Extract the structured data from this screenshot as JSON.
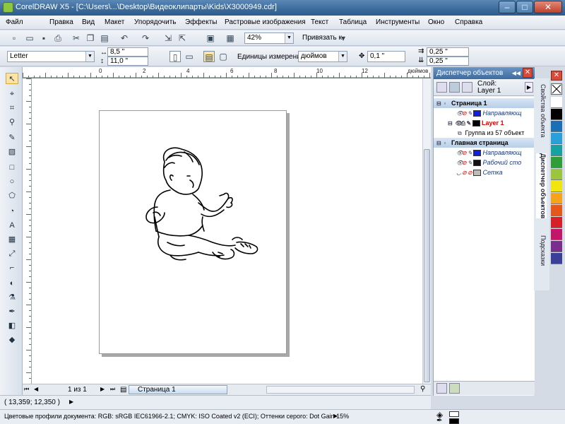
{
  "window": {
    "title": "CorelDRAW X5 - [C:\\Users\\...\\Desktop\\Видеоклипарты\\Kids\\X3000949.cdr]",
    "minimize": "–",
    "maximize": "□",
    "close": "✕"
  },
  "menu": [
    "Файл",
    "Правка",
    "Вид",
    "Макет",
    "Упорядочить",
    "Эффекты",
    "Растровые изображения",
    "Текст",
    "Таблица",
    "Инструменты",
    "Окно",
    "Справка"
  ],
  "toolbar": {
    "zoom": "42%",
    "snap_label": "Привязать к"
  },
  "property_bar": {
    "paper": "Letter",
    "width": "8,5 \"",
    "height": "11,0 \"",
    "units_label": "Единицы измерения:",
    "units_value": "дюймов",
    "nudge": "0,1 \"",
    "dup_x": "0,25 \"",
    "dup_y": "0,25 \""
  },
  "ruler": {
    "top_ticks": [
      "0",
      "2",
      "4",
      "6",
      "8",
      "10",
      "12"
    ],
    "top_unit": "дюймов",
    "left_ticks": [
      "12",
      "10",
      "8",
      "6",
      "4",
      "2",
      "0"
    ],
    "left_unit": "дюймов"
  },
  "page_nav": {
    "counter": "1 из 1",
    "tab": "Страница 1"
  },
  "status": {
    "coords": "( 13,359; 12,350 )",
    "profiles": "Цветовые профили документа: RGB: sRGB IEC61966-2.1; CMYK: ISO Coated v2 (ECI); Оттенки серого: Dot Gain 15%"
  },
  "docker": {
    "title": "Диспетчер объектов",
    "layer_label": "Слой:",
    "layer_name": "Layer 1",
    "rows": [
      {
        "text": "Страница 1",
        "kind": "head",
        "color": ""
      },
      {
        "text": "Направляющ",
        "kind": "item",
        "color": "#1020e0"
      },
      {
        "text": "Layer 1",
        "kind": "item-red",
        "color": "#000000"
      },
      {
        "text": "Группа из 57 объект",
        "kind": "child",
        "color": ""
      },
      {
        "text": "Главная страница",
        "kind": "head",
        "color": ""
      },
      {
        "text": "Направляющ",
        "kind": "item",
        "color": "#1020e0"
      },
      {
        "text": "Рабочий сто",
        "kind": "item",
        "color": "#111111"
      },
      {
        "text": "Сетка",
        "kind": "item",
        "color": "#bbbbbb"
      }
    ]
  },
  "side_tabs": [
    "Свойства объекта",
    "Диспетчер объектов",
    "Подсказки"
  ],
  "palette": [
    "#ffffff",
    "#000000",
    "#1a6fb5",
    "#2aa0d8",
    "#17a2a2",
    "#2f9e3a",
    "#9bc53d",
    "#f1e40f",
    "#f7a21b",
    "#e4581a",
    "#d61f26",
    "#c2166b",
    "#7b2d8e",
    "#3b3f97"
  ],
  "fill_indicator": {
    "fill": "#000000",
    "outline": "none"
  }
}
